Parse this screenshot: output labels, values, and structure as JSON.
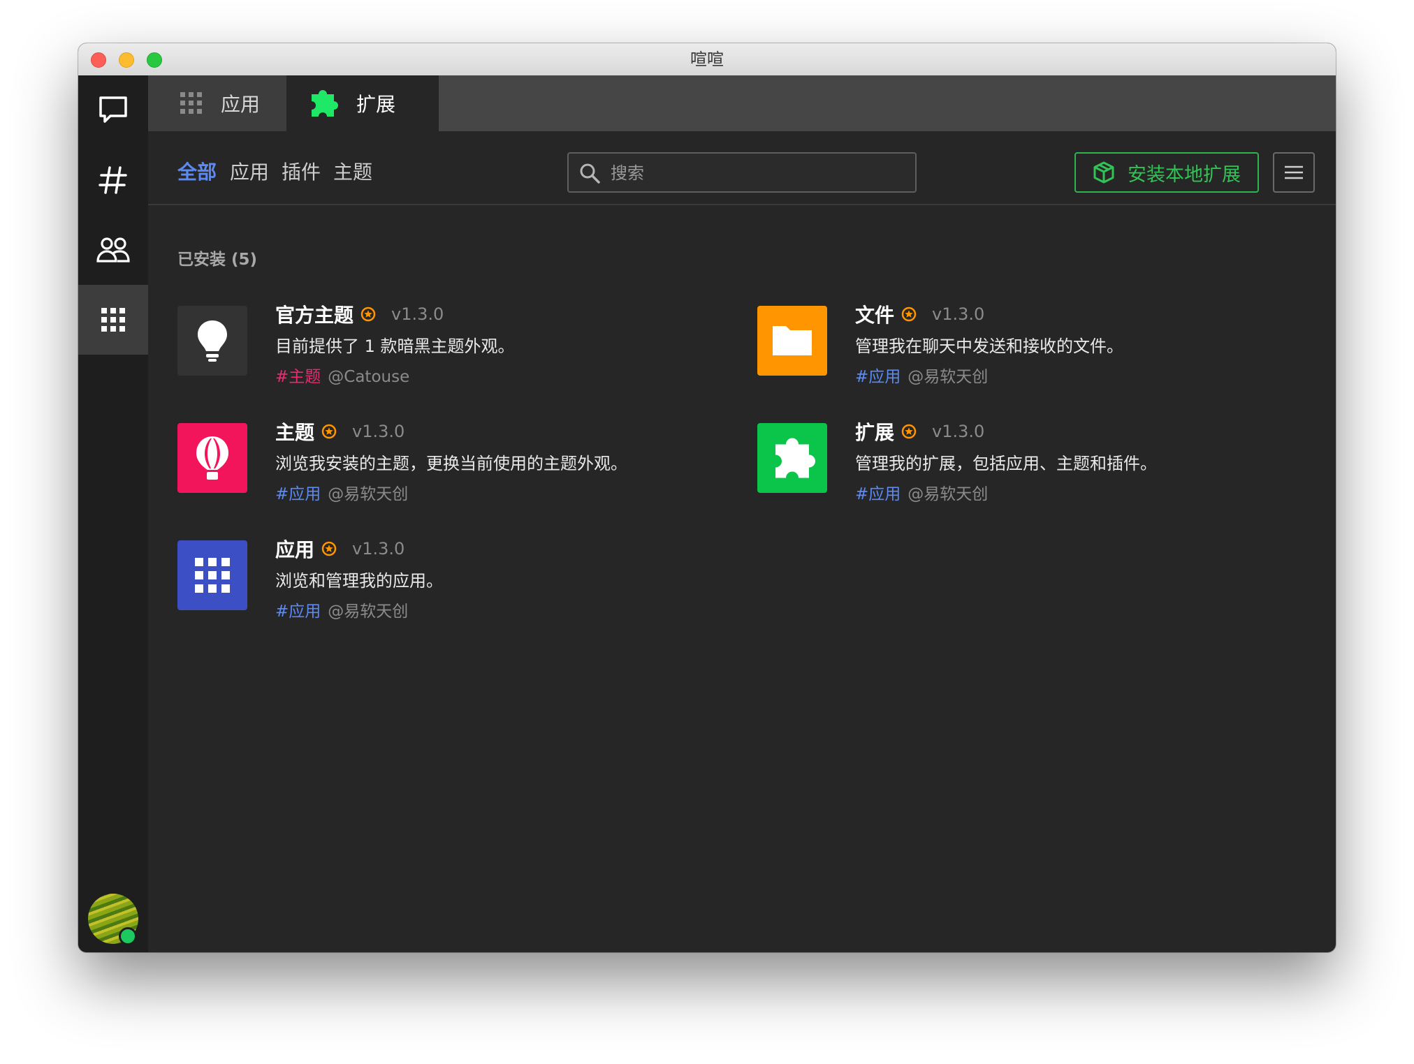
{
  "window": {
    "title": "喧喧"
  },
  "tabs": [
    {
      "label": "应用",
      "icon": "grid-icon"
    },
    {
      "label": "扩展",
      "icon": "puzzle-icon",
      "active": true
    }
  ],
  "left_nav": [
    {
      "name": "chat",
      "icon": "chat-icon"
    },
    {
      "name": "channels",
      "icon": "hashtag-icon"
    },
    {
      "name": "contacts",
      "icon": "contacts-icon"
    },
    {
      "name": "apps",
      "icon": "apps-grid-icon",
      "active": true
    }
  ],
  "filters": [
    {
      "label": "全部",
      "active": true
    },
    {
      "label": "应用"
    },
    {
      "label": "插件"
    },
    {
      "label": "主题"
    }
  ],
  "search": {
    "placeholder": "搜索",
    "value": ""
  },
  "install_button": {
    "label": "安装本地扩展",
    "color": "#2fb44f"
  },
  "section": {
    "title": "已安装 (5)"
  },
  "extensions": [
    {
      "name": "官方主题",
      "version": "v1.3.0",
      "description": "目前提供了 1 款暗黑主题外观。",
      "tag": "#主题",
      "author": "@Catouse",
      "icon": "lightbulb-icon",
      "icon_bg": "#333333"
    },
    {
      "name": "文件",
      "version": "v1.3.0",
      "description": "管理我在聊天中发送和接收的文件。",
      "tag": "#应用",
      "author": "@易软天创",
      "icon": "folder-icon",
      "icon_bg": "#ff9500"
    },
    {
      "name": "主题",
      "version": "v1.3.0",
      "description": "浏览我安装的主题，更换当前使用的主题外观。",
      "tag": "#应用",
      "author": "@易软天创",
      "icon": "balloon-icon",
      "icon_bg": "#f2155b"
    },
    {
      "name": "扩展",
      "version": "v1.3.0",
      "description": "管理我的扩展，包括应用、主题和插件。",
      "tag": "#应用",
      "author": "@易软天创",
      "icon": "puzzle-icon",
      "icon_bg": "#0bc44a"
    },
    {
      "name": "应用",
      "version": "v1.3.0",
      "description": "浏览和管理我的应用。",
      "tag": "#应用",
      "author": "@易软天创",
      "icon": "grid-icon",
      "icon_bg": "#3c4fc4"
    }
  ],
  "colors": {
    "accent": "#5b8af5",
    "background": "#262626",
    "sidebar": "#1e1e1e",
    "star": "#ff9500",
    "theme_tag": "#ea2a72"
  },
  "user": {
    "status": "online"
  }
}
